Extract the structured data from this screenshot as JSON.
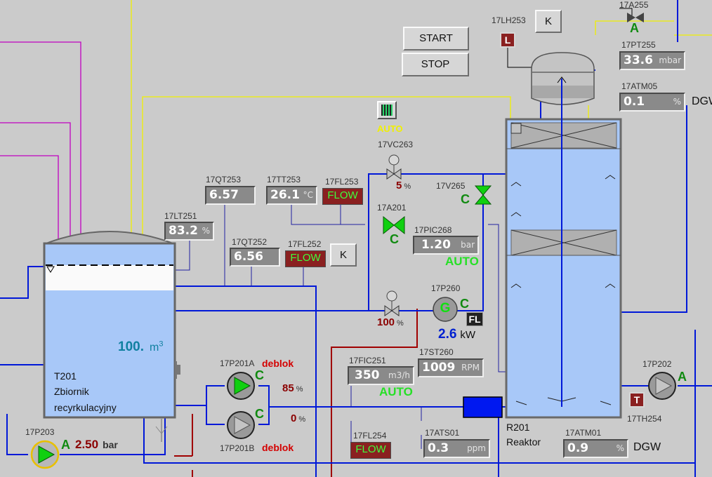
{
  "buttons": {
    "start": "START",
    "stop": "STOP",
    "k": "K"
  },
  "tank": {
    "id": "T201",
    "name_line1": "Zbiornik",
    "name_line2": "recyrkulacyjny",
    "volume": "100.",
    "volume_unit": "m",
    "volume_exp": "3"
  },
  "reactor": {
    "id": "R201",
    "name": "Reaktor"
  },
  "valve_auto": "AUTO",
  "instruments": {
    "qt253": {
      "tag": "17QT253",
      "value": "6.57"
    },
    "tt253": {
      "tag": "17TT253",
      "value": "26.1",
      "unit": "°C"
    },
    "fl253": {
      "tag": "17FL253",
      "value": "FLOW"
    },
    "lt251": {
      "tag": "17LT251",
      "value": "83.2",
      "unit": "%"
    },
    "qt252": {
      "tag": "17QT252",
      "value": "6.56"
    },
    "fl252": {
      "tag": "17FL252",
      "value": "FLOW"
    },
    "vc263": {
      "tag": "17VC263",
      "value": "5",
      "unit": "%"
    },
    "v265": {
      "tag": "17V265",
      "state": "C"
    },
    "a201": {
      "tag": "17A201",
      "state": "C"
    },
    "pic268": {
      "tag": "17PIC268",
      "value": "1.20",
      "unit": "bar",
      "mode": "AUTO"
    },
    "p260": {
      "tag": "17P260",
      "symbol": "G",
      "state": "C",
      "fl": "FL",
      "power": "2.6",
      "power_unit": "kW"
    },
    "valve_bottom": {
      "value": "100",
      "unit": "%"
    },
    "st260": {
      "tag": "17ST260",
      "value": "1009",
      "unit": "RPM"
    },
    "fic251": {
      "tag": "17FIC251",
      "value": "350",
      "unit": "m3/h",
      "mode": "AUTO"
    },
    "p201a": {
      "tag": "17P201A",
      "state": "C",
      "status": "deblok",
      "value": "85",
      "unit": "%"
    },
    "p201b": {
      "tag": "17P201B",
      "state": "C",
      "status": "deblok",
      "value": "0",
      "unit": "%"
    },
    "p203": {
      "tag": "17P203",
      "state": "A",
      "value": "2.50",
      "unit": "bar"
    },
    "fl254": {
      "tag": "17FL254",
      "value": "FLOW"
    },
    "ats01": {
      "tag": "17ATS01",
      "value": "0.3",
      "unit": "ppm"
    },
    "atm01": {
      "tag": "17ATM01",
      "value": "0.9",
      "unit": "%",
      "label": "DGW"
    },
    "p202": {
      "tag": "17P202",
      "state": "A"
    },
    "th254": {
      "tag": "17TH254",
      "symbol": "T"
    },
    "lh253": {
      "tag": "17LH253",
      "symbol": "L"
    },
    "a255": {
      "tag": "17A255",
      "state": "A"
    },
    "pt255": {
      "tag": "17PT255",
      "value": "33.6",
      "unit": "mbar"
    },
    "atm05": {
      "tag": "17ATM05",
      "value": "0.1",
      "unit": "%",
      "label": "DGW"
    }
  },
  "colors": {
    "background": "#cbcbcb",
    "pipe_blue": "#0018d8",
    "pipe_magenta": "#c000c0",
    "pipe_yellow": "#f0f000",
    "pipe_red": "#a00000",
    "liquid": "#a8c8f8",
    "pump_green": "#10d010"
  }
}
